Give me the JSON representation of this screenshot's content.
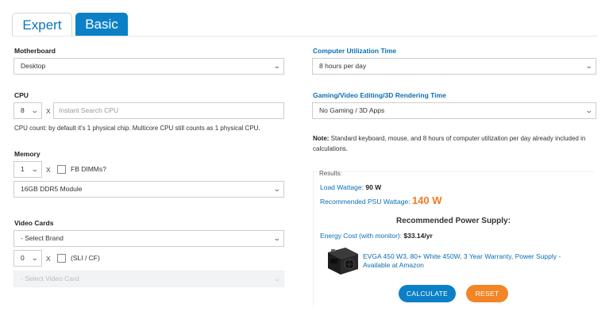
{
  "tabs": {
    "expert": "Expert",
    "basic": "Basic"
  },
  "left": {
    "motherboard": {
      "label": "Motherboard",
      "value": "Desktop"
    },
    "cpu": {
      "label": "CPU",
      "count": "8",
      "x": "X",
      "placeholder": "Instant Search CPU",
      "help": "CPU count: by default it's 1 physical chip. Multicore CPU still counts as 1 physical CPU."
    },
    "memory": {
      "label": "Memory",
      "count": "1",
      "x": "X",
      "fb_label": "FB DIMMs?",
      "module": "16GB DDR5 Module"
    },
    "video": {
      "label": "Video Cards",
      "brand": "- Select Brand",
      "count": "0",
      "x": "X",
      "sli_label": "(SLI / CF)",
      "card": "- Select Video Card"
    }
  },
  "right": {
    "util": {
      "label": "Computer Utilization Time",
      "value": "8 hours per day"
    },
    "gaming": {
      "label": "Gaming/Video Editing/3D Rendering Time",
      "value": "No Gaming / 3D Apps"
    },
    "note_bold": "Note:",
    "note_text": " Standard keyboard, mouse, and 8 hours of computer utilization per day already included in calculations.",
    "results": {
      "legend": "Results:",
      "load_label": "Load Wattage:",
      "load_value": "90 W",
      "psu_label": "Recommended PSU Wattage:",
      "psu_value": "140 W",
      "rec_title": "Recommended Power Supply:",
      "cost_label": "Energy Cost (with monitor):",
      "cost_value": "$33.14/yr",
      "product_link": "EVGA 450 W3, 80+ White 450W, 3 Year Warranty, Power Supply - Available at Amazon"
    },
    "buttons": {
      "calculate": "CALCULATE",
      "reset": "RESET"
    }
  }
}
